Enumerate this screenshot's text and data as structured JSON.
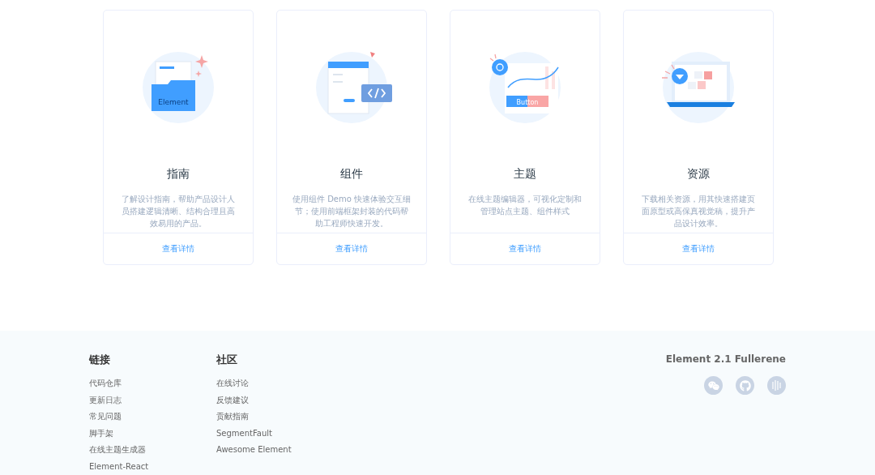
{
  "cards": [
    {
      "kind": "folder",
      "illustration_label": "Element",
      "title": "指南",
      "description": "了解设计指南，帮助产品设计人员搭建逻辑清晰、结构合理且高效易用的产品。",
      "link": "查看详情"
    },
    {
      "kind": "code",
      "title": "组件",
      "description": "使用组件 Demo 快速体验交互细节；使用前端框架封装的代码帮助工程师快速开发。",
      "link": "查看详情"
    },
    {
      "kind": "theme",
      "illustration_label": "Button",
      "title": "主题",
      "description": "在线主题编辑器，可视化定制和管理站点主题、组件样式",
      "link": "查看详情"
    },
    {
      "kind": "laptop",
      "title": "资源",
      "description": "下载相关资源，用其快速搭建页面原型或高保真视觉稿，提升产品设计效率。",
      "link": "查看详情"
    }
  ],
  "footer": {
    "columns": [
      {
        "heading": "链接",
        "items": [
          "代码仓库",
          "更新日志",
          "常见问题",
          "脚手架",
          "在线主题生成器",
          "Element-React"
        ]
      },
      {
        "heading": "社区",
        "items": [
          "在线讨论",
          "反馈建议",
          "贡献指南",
          "SegmentFault",
          "Awesome Element"
        ]
      }
    ],
    "version": "Element 2.1 Fullerene",
    "social": [
      {
        "kind": "chat"
      },
      {
        "kind": "cat"
      },
      {
        "kind": "bars"
      }
    ]
  }
}
